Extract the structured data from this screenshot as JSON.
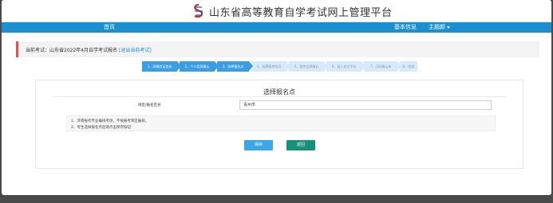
{
  "header": {
    "title": "山东省高等教育自学考试网上管理平台",
    "logo_icon": "sd-exam-logo-icon"
  },
  "nav": {
    "home": "首页",
    "basic_info": "基本信息",
    "theme": "主题颜"
  },
  "exam": {
    "prefix": "当前考试：山东省2022年4月自学考试报名",
    "exit_link": "[退出当前考试]"
  },
  "steps": [
    {
      "label": "1、资格验证信息",
      "state": "done"
    },
    {
      "label": "2、个人信息确认",
      "state": "done"
    },
    {
      "label": "3、选择报名点",
      "state": "done"
    },
    {
      "label": "4、选择报考科目",
      "state": "todo"
    },
    {
      "label": "5、报考信息确认",
      "state": "todo"
    },
    {
      "label": "6、进入支付平台",
      "state": "todo"
    },
    {
      "label": "7、打印确认单",
      "state": "todo"
    },
    {
      "label": "8、完成",
      "state": "todo"
    }
  ],
  "panel": {
    "title": "选择报名点",
    "field_label": "地区/报名区县",
    "field_value": "青州市",
    "notes": [
      "1、济南报考专业编排考场，不按报考到区编排。",
      "2、考生选择报名点后请点击保存按钮"
    ],
    "save": "保存",
    "back": "返回"
  },
  "colors": {
    "nav": "#1a8fd1",
    "step_done": "#3b9ee3",
    "step_todo": "#d7eafa",
    "save": "#3aa8e8",
    "back": "#17907a",
    "accent_border": "#d9534f"
  }
}
